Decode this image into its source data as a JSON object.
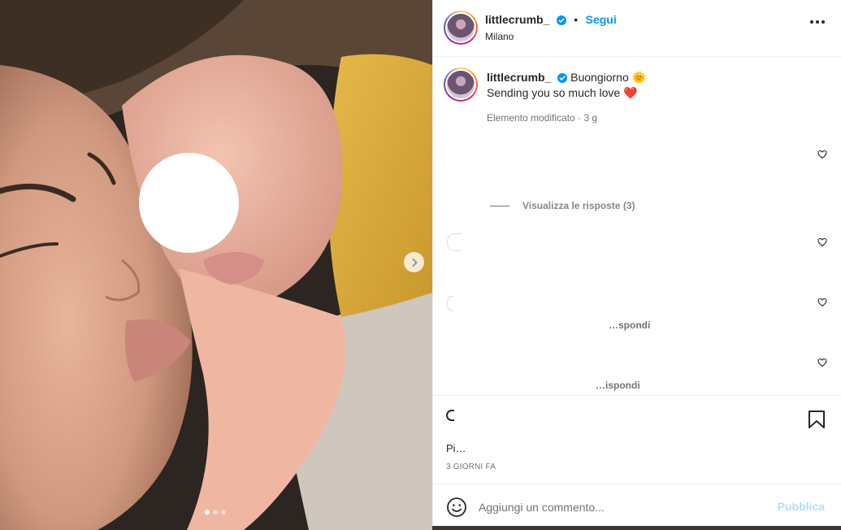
{
  "post": {
    "username": "littlecrumb_",
    "follow_label": "Segui",
    "separator": "•",
    "location": "Milano",
    "more_icon": "more-horizontal-icon"
  },
  "caption": {
    "username": "littlecrumb_",
    "line1": "Buongiorno",
    "sun_emoji": "🌞",
    "line2": "Sending you so much love",
    "heart_emoji": "❤️",
    "meta": "Elemento modificato · 3 g"
  },
  "comments": {
    "view_replies": "Visualizza le risposte (3)",
    "reply_label_1": "…spondi",
    "reply_label_2": "…ispondi"
  },
  "actions": {
    "partial_text": "Pi…",
    "timestamp": "3 GIORNI FA"
  },
  "comment_box": {
    "placeholder": "Aggiungi un commento...",
    "publish_label": "Pubblica"
  },
  "carousel": {
    "count": 3,
    "active_index": 0
  },
  "colors": {
    "accent": "#0095f6",
    "publish_disabled": "#b2dffc",
    "secondary_text": "#737373"
  }
}
